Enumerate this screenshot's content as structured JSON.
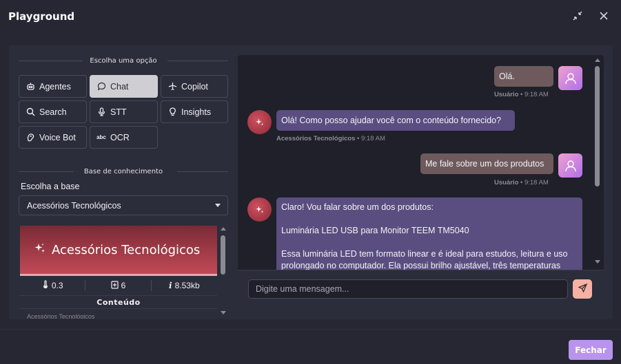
{
  "header": {
    "title": "Playground",
    "icons": [
      "minimize-icon",
      "close-icon"
    ]
  },
  "options": {
    "heading": "Escolha uma opção",
    "items": [
      {
        "label": "Agentes",
        "icon": "robot-icon",
        "active": false
      },
      {
        "label": "Chat",
        "icon": "chat-bubble-icon",
        "active": true
      },
      {
        "label": "Copilot",
        "icon": "plane-icon",
        "active": false
      },
      {
        "label": "Search",
        "icon": "search-icon",
        "active": false
      },
      {
        "label": "STT",
        "icon": "microphone-icon",
        "active": false
      },
      {
        "label": "Insights",
        "icon": "lightbulb-icon",
        "active": false
      },
      {
        "label": "Voice Bot",
        "icon": "voice-icon",
        "active": false
      },
      {
        "label": "OCR",
        "icon": "abc-icon",
        "active": false
      }
    ]
  },
  "knowledge": {
    "heading": "Base de conhecimento",
    "label": "Escolha a base",
    "selected": "Acessórios Tecnológicos",
    "card": {
      "name": "Acessórios Tecnológicos",
      "temperature": "0.3",
      "docs": "6",
      "size": "8.53kb",
      "content_label": "Conteúdo",
      "cut_text": "Acessórios Tecnológicos"
    }
  },
  "chat": {
    "messages": [
      {
        "role": "user",
        "text": "Olá.",
        "meta_name": "Usuário",
        "meta_time": "• 9:18 AM"
      },
      {
        "role": "bot",
        "text": "Olá! Como posso ajudar você com o conteúdo fornecido?",
        "meta_name": "Acessórios Tecnológicos",
        "meta_time": "• 9:18 AM"
      },
      {
        "role": "user",
        "text": "Me fale sobre um dos produtos",
        "meta_name": "Usuário",
        "meta_time": "• 9:18 AM"
      },
      {
        "role": "bot",
        "paragraphs": [
          "Claro! Vou falar sobre um dos produtos:",
          "Luminária LED USB para Monitor TEEM TM5040",
          "Essa luminária LED tem formato linear e é ideal para estudos, leitura e uso prolongado no computador. Ela possui brilho ajustável, três temperaturas"
        ]
      }
    ],
    "input_placeholder": "Digite uma mensagem..."
  },
  "footer": {
    "close_label": "Fechar"
  },
  "colors": {
    "accent": "#b994ec",
    "user_bubble": "#6e5a5c",
    "bot_bubble": "#5a4e80",
    "send": "#f6b1a5"
  }
}
